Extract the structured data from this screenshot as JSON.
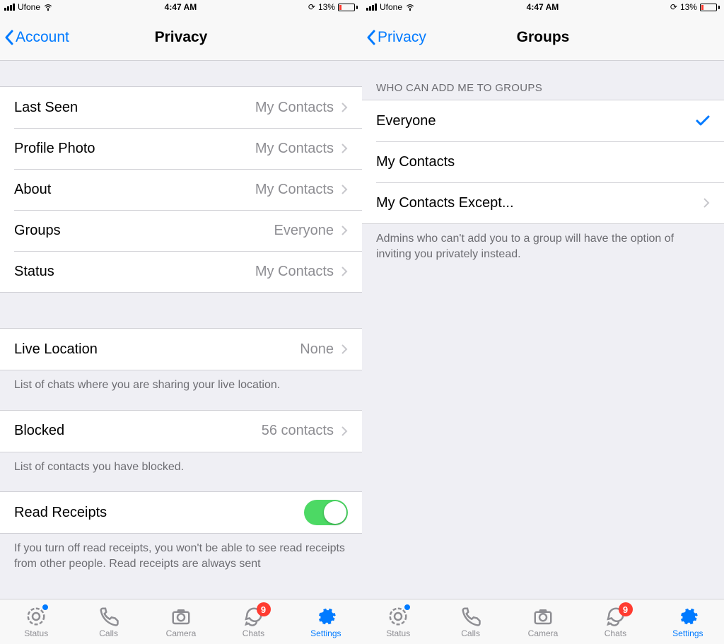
{
  "statusBar": {
    "carrier": "Ufone",
    "time": "4:47 AM",
    "batteryPercent": "13%"
  },
  "left": {
    "back": "Account",
    "title": "Privacy",
    "rows": {
      "lastSeen": {
        "label": "Last Seen",
        "value": "My Contacts"
      },
      "profilePhoto": {
        "label": "Profile Photo",
        "value": "My Contacts"
      },
      "about": {
        "label": "About",
        "value": "My Contacts"
      },
      "groups": {
        "label": "Groups",
        "value": "Everyone"
      },
      "status": {
        "label": "Status",
        "value": "My Contacts"
      },
      "liveLocation": {
        "label": "Live Location",
        "value": "None"
      },
      "blocked": {
        "label": "Blocked",
        "value": "56 contacts"
      },
      "readReceipts": {
        "label": "Read Receipts"
      }
    },
    "footers": {
      "liveLocation": "List of chats where you are sharing your live location.",
      "blocked": "List of contacts you have blocked.",
      "readReceipts": "If you turn off read receipts, you won't be able to see read receipts from other people. Read receipts are always sent"
    }
  },
  "right": {
    "back": "Privacy",
    "title": "Groups",
    "sectionHeader": "WHO CAN ADD ME TO GROUPS",
    "options": {
      "everyone": "Everyone",
      "myContacts": "My Contacts",
      "except": "My Contacts Except..."
    },
    "footer": "Admins who can't add you to a group will have the option of inviting you privately instead."
  },
  "tabs": {
    "status": "Status",
    "calls": "Calls",
    "camera": "Camera",
    "chats": "Chats",
    "settings": "Settings",
    "chatsBadge": "9"
  }
}
